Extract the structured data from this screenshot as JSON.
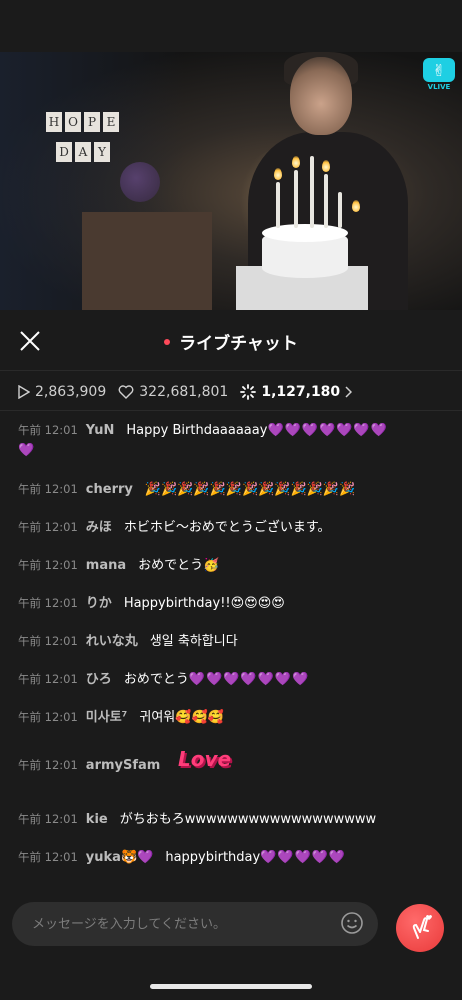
{
  "video": {
    "sign_top": [
      "H",
      "O",
      "P",
      "E"
    ],
    "sign_bottom": [
      "D",
      "A",
      "Y"
    ],
    "logo_label": "VLIVE"
  },
  "header": {
    "title": "ライブチャット"
  },
  "stats": {
    "plays": "2,863,909",
    "hearts": "322,681,801",
    "viewers": "1,127,180"
  },
  "messages": [
    {
      "time": "午前 12:01",
      "user": "YuN",
      "text": "Happy Birthdaaaaaay",
      "hearts": "💜💜💜💜💜💜💜",
      "hearts2": "💜"
    },
    {
      "time": "午前 12:01",
      "user": "cherry",
      "text": "🎉🎉🎉🎉🎉🎉🎉🎉🎉🎉🎉🎉🎉"
    },
    {
      "time": "午前 12:01",
      "user": "みほ",
      "text": "ホビホビ〜おめでとうございます。"
    },
    {
      "time": "午前 12:01",
      "user": "mana",
      "text": "おめでとう🥳"
    },
    {
      "time": "午前 12:01",
      "user": "りか",
      "text": "Happybirthday!!😍😍😍😍"
    },
    {
      "time": "午前 12:01",
      "user": "れいな丸",
      "text": "생일 축하합니다"
    },
    {
      "time": "午前 12:01",
      "user": "ひろ",
      "text": "おめでとう",
      "hearts": "💜💜💜💜💜💜💜"
    },
    {
      "time": "午前 12:01",
      "user": "미사토⁷",
      "text": "귀여워🥰🥰🥰"
    },
    {
      "time": "午前 12:01",
      "user": "armySfam",
      "text": "",
      "sticker": "Love"
    },
    {
      "time": "午前 12:01",
      "user": "kie",
      "text": "がちおもろwwwwwwwwwwwwwwwwww"
    },
    {
      "time": "午前 12:01",
      "user": "yuka🐯💜",
      "text": "happybirthday",
      "hearts": "💜💜💜💜💜"
    }
  ],
  "input": {
    "placeholder": "メッセージを入力してください。"
  },
  "colors": {
    "background": "#1b1b1b",
    "live_dot": "#ff4a5a",
    "heart_button": "#e93a3a",
    "vlive": "#1ecfe3"
  }
}
